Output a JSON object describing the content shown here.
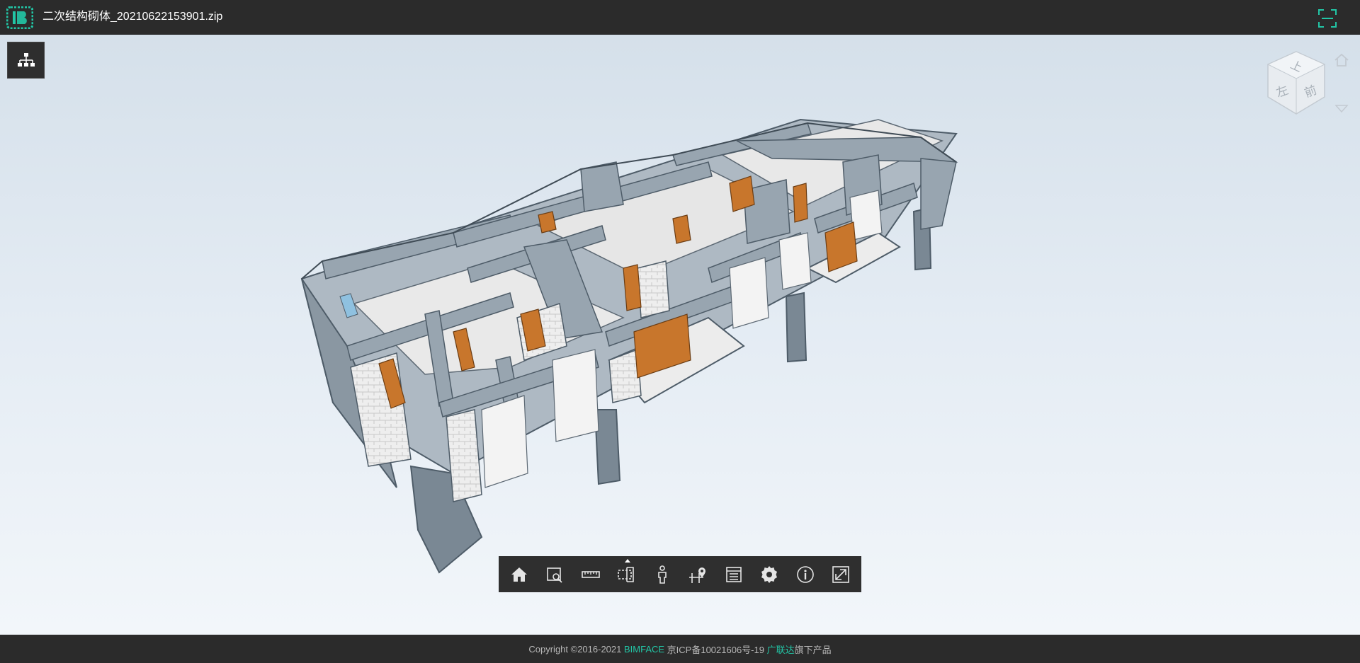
{
  "header": {
    "file_name": "二次结构砌体_20210622153901.zip",
    "logo_icon": "bimface-logo-icon",
    "scan_icon": "fullscreen-scan-icon",
    "accent_color": "#22c6a6"
  },
  "viewport": {
    "tree_button_icon": "model-tree-icon",
    "viewcube": {
      "top_label": "上",
      "left_label": "左",
      "front_label": "前",
      "home_icon": "home-icon",
      "menu_icon": "chevron-down-icon"
    }
  },
  "toolbar": {
    "tools": [
      {
        "name": "home-view",
        "icon": "home-icon"
      },
      {
        "name": "zoom-box",
        "icon": "zoom-box-icon"
      },
      {
        "name": "measure",
        "icon": "ruler-icon"
      },
      {
        "name": "section",
        "icon": "section-box-icon"
      },
      {
        "name": "walk",
        "icon": "person-icon"
      },
      {
        "name": "map",
        "icon": "map-pin-icon"
      },
      {
        "name": "properties",
        "icon": "list-icon"
      },
      {
        "name": "settings",
        "icon": "gear-icon"
      },
      {
        "name": "info",
        "icon": "info-icon"
      },
      {
        "name": "fullscreen",
        "icon": "fullscreen-icon"
      }
    ]
  },
  "footer": {
    "copyright": "Copyright ©2016-2021 ",
    "brand": "BIMFACE",
    "icp": " 京ICP备10021606号-19 ",
    "company": "广联达",
    "suffix": "旗下产品"
  }
}
